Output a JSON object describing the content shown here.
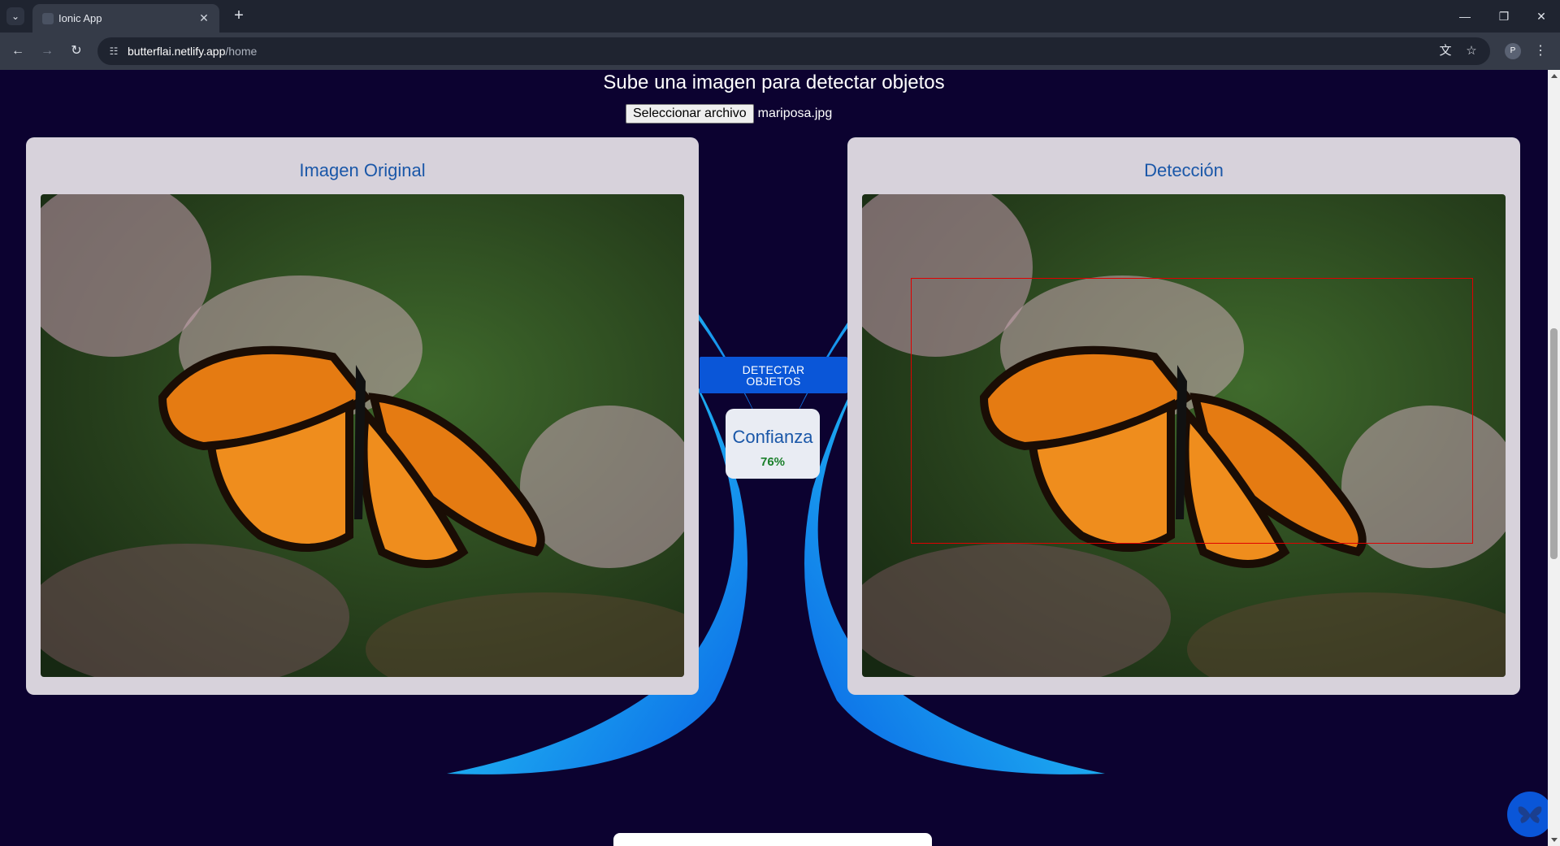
{
  "browser": {
    "tab_title": "Ionic App",
    "tab_close": "✕",
    "new_tab": "+",
    "url_host": "butterflai.netlify.app",
    "url_path": "/home",
    "profile_initial": "P",
    "window_minimize": "—",
    "window_restore": "❐",
    "window_close": "✕"
  },
  "page": {
    "heading": "Sube una imagen para detectar objetos",
    "file_button_label": "Seleccionar archivo",
    "file_name": "mariposa.jpg",
    "original_panel_title": "Imagen Original",
    "detection_panel_title": "Detección",
    "detect_button_label": "DETECTAR OBJETOS",
    "confidence_label": "Confianza",
    "confidence_value": "76%"
  },
  "icons": {
    "tab_list": "chevron-down-icon",
    "back": "arrow-left-icon",
    "forward": "arrow-right-icon",
    "reload": "reload-icon",
    "site_info": "site-info-icon",
    "translate": "translate-icon",
    "bookmark": "star-icon",
    "menu": "kebab-menu-icon",
    "fab": "butterfly-icon"
  },
  "colors": {
    "page_background": "#0c0230",
    "accent_blue": "#0a56d8",
    "title_blue": "#1a57a8",
    "confidence_green": "#1a7f2a",
    "bounding_box": "#e00000",
    "panel_background": "#d7d2db"
  }
}
